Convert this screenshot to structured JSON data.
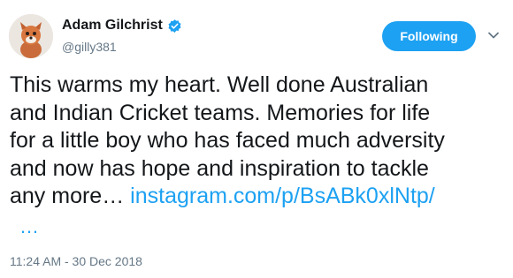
{
  "user": {
    "display_name": "Adam Gilchrist",
    "handle": "@gilly381",
    "verified_icon": "verified-badge-icon",
    "avatar_icon": "avatar"
  },
  "actions": {
    "follow_label": "Following",
    "menu_icon": "chevron-down-icon"
  },
  "tweet": {
    "text": "This warms my heart. Well done Australian\nand Indian Cricket teams. Memories for life\nfor a little boy who has faced much adversity\nand now has hope and inspiration to tackle\nany more… ",
    "link": "instagram.com/p/BsABk0xlNtp/",
    "more": "…"
  },
  "meta": {
    "timestamp": "11:24 AM - 30 Dec 2018"
  },
  "colors": {
    "accent": "#1da1f2",
    "text": "#14171a",
    "muted": "#657786"
  }
}
